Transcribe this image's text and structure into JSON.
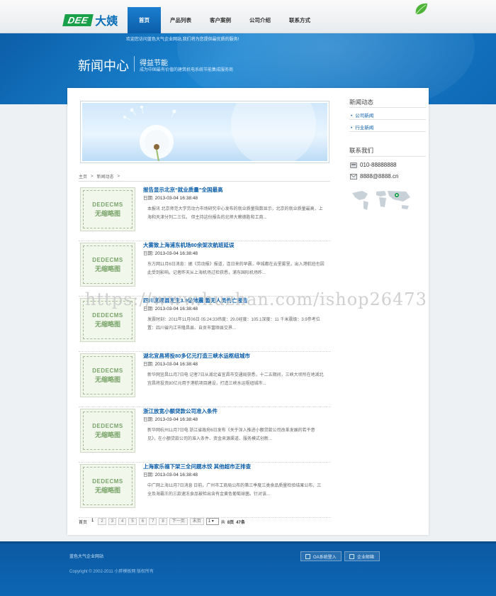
{
  "brand": {
    "logo_mark": "DEE",
    "logo_text": "大姨"
  },
  "nav": [
    "首页",
    "产品列表",
    "客户案例",
    "公司介绍",
    "联系方式"
  ],
  "banner": {
    "welcome": "欢迎您访问蓝色大气企业网站,我们将为您提供最优质的服务!",
    "page_title": "新闻中心",
    "slogan_title": "得益节能",
    "slogan_sub": "成为中国最有价值的建筑机电系统节能集成服务商"
  },
  "breadcrumb": [
    "主页",
    "新闻动态"
  ],
  "thumb_placeholder": {
    "line1": "DEDECMS",
    "line2": "无缩略图"
  },
  "date_label": "日期:",
  "news": [
    {
      "title": "报告显示北京“就业质量”全国最高",
      "date": "2013-03-04 16:38:48",
      "summary": "本报讯 北京师范大学劳动力市场研究中心发布的就业质量指数显示，北京的就业质量最高，上海和天津分列二三位。 但主持这份报告的北师大赖德胜和工商..."
    },
    {
      "title": "大雾致上海浦东机场80余架次航班延误",
      "date": "2013-03-04 16:38:48",
      "summary": "东方网11月6日消息：据《劳动报》报道，连日来的早晨，申城都在云里雾里，出入港航班也因此受到影响。记者昨天从上海机场过检获悉，浦东国际机场昨..."
    },
    {
      "title": "四川富顺县发生3.9级地震 暂无人员伤亡报告",
      "date": "2013-03-04 16:38:48",
      "summary": "发震时刻：2011年11月06日 05:24:33纬度：29.0经度：105.1深度：11 千米震级：3.9参考位置：四川省内江市隆昌县、自贡市富顺县交界..."
    },
    {
      "title": "湖北宜昌将投80多亿元打造三峡水运枢纽城市",
      "date": "2013-03-04 16:38:48",
      "summary": "新华网宜昌11月7日电 记者7日从湖北省宜昌市交通局获悉，十二五期间，三峡大坝所在地湖北宜昌将投资80亿元用于港航项目建设，打造三峡水运枢纽城市..."
    },
    {
      "title": "浙江放宽小额贷款公司准入条件",
      "date": "2013-03-04 16:38:48",
      "summary": "新华网杭州11月7日电 浙江省政府6日发布《关于深入推进小额贷款公司改革发展的若干意见》，在小额贷款公司的准入条件、资金来源渠道、服务模式创新..."
    },
    {
      "title": "上海家乐福下架三全问题水饺 其他超市正排查",
      "date": "2013-03-04 16:38:48",
      "summary": "中广网上海11月7日消息 日前，广州市工商局公布的第三季度三类食品质量检验结果公布，三全及海霸王的三款速冻食品被检出含有金黄色葡萄球菌。针对该..."
    }
  ],
  "pager": {
    "first": "首页",
    "pages": [
      "1",
      "2",
      "3",
      "4",
      "5",
      "6",
      "7",
      "8"
    ],
    "next": "下一页",
    "last": "末页",
    "select_value": "1",
    "summary_prefix": "共",
    "summary_pages": "8页",
    "summary_records": "47条"
  },
  "sidebar": {
    "news_heading": "新闻动态",
    "news_links": [
      "公司新闻",
      "行业新闻"
    ],
    "contact_heading": "联系我们",
    "phone": "010-88888888",
    "email": "8888@8888.cn"
  },
  "watermark": "https://www.huzhan.com/ishop26473",
  "footer": {
    "site_name": "蓝色大气企业网站",
    "copyright": "Copyright © 2002-2011 小胖模板网 版权所有",
    "oa_button": "OA系统登入",
    "mail_button": "企业邮箱"
  },
  "colors": {
    "brand_blue": "#0b5ea8",
    "logo_green": "#1aa04a",
    "link_blue": "#0a5da8"
  }
}
